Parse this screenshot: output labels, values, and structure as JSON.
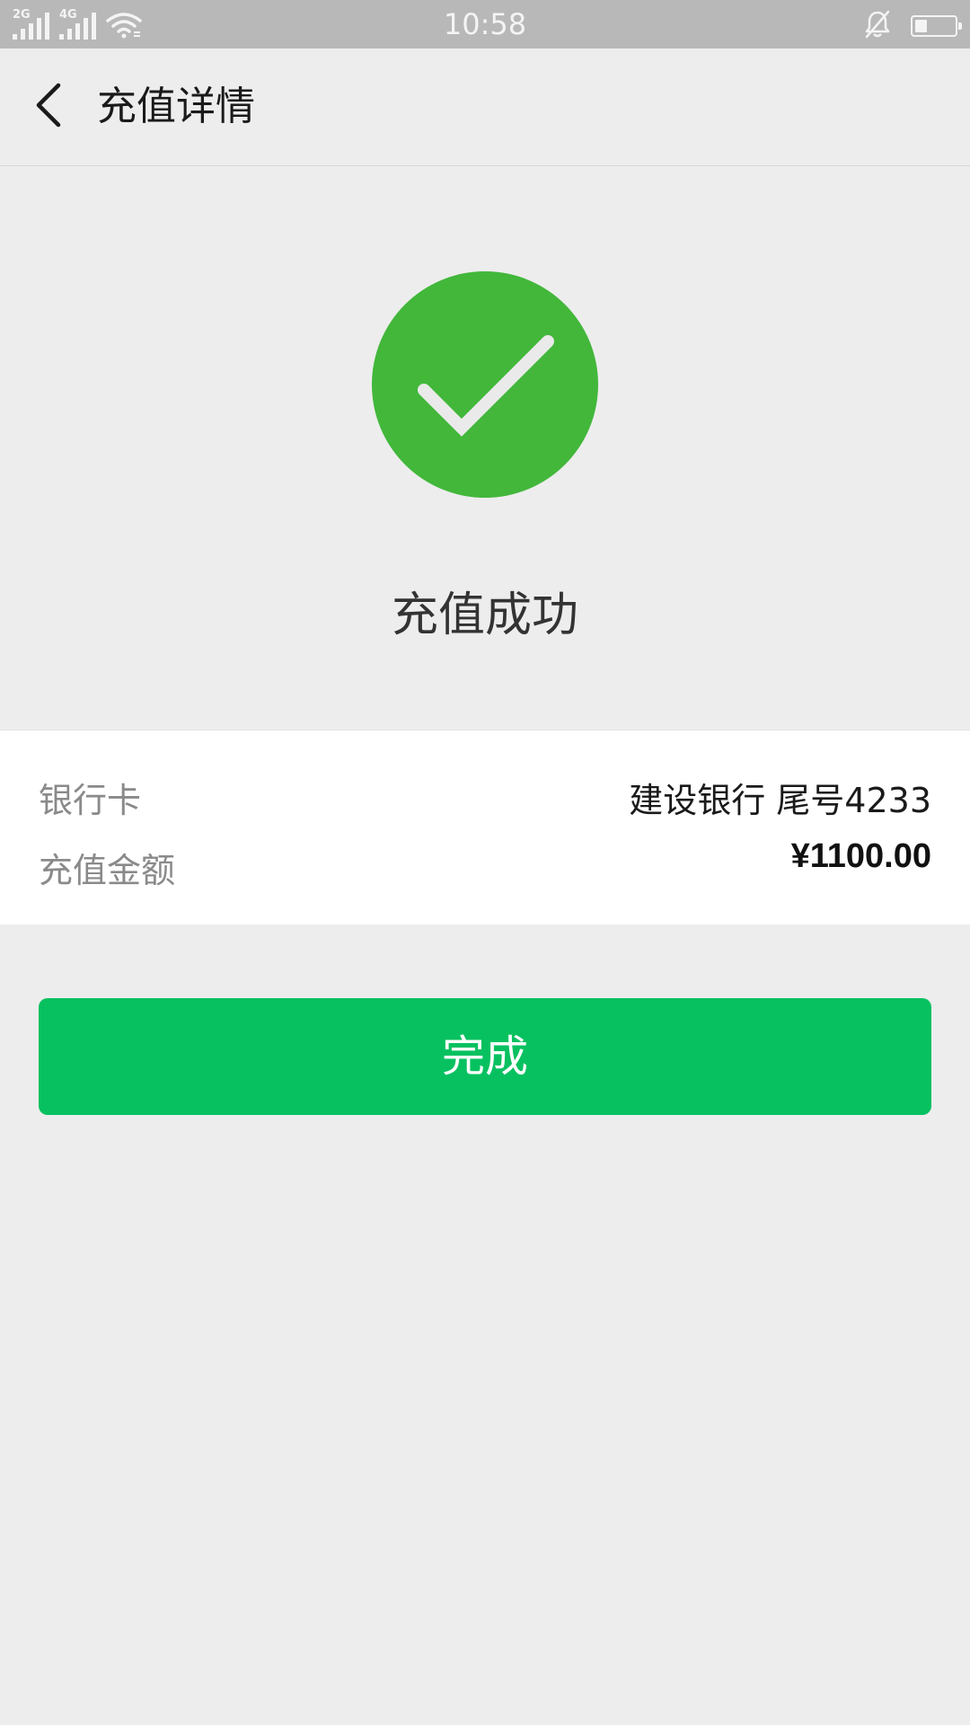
{
  "status_bar": {
    "sim1_network": "2G",
    "sim2_network": "4G",
    "time": "10:58",
    "battery_level": 0.3
  },
  "header": {
    "title": "充值详情"
  },
  "result": {
    "message": "充值成功",
    "icon": "check-circle-icon",
    "color": "#42b73a"
  },
  "details": {
    "bank_card_label": "银行卡",
    "bank_card_value": "建设银行 尾号4233",
    "amount_label": "充值金额",
    "amount_value": "¥1100.00"
  },
  "actions": {
    "done_label": "完成",
    "done_color": "#07c160"
  }
}
